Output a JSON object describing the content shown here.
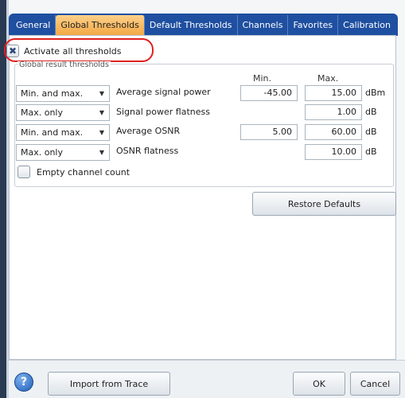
{
  "tabs": [
    {
      "label": "General",
      "active": false
    },
    {
      "label": "Global Thresholds",
      "active": true
    },
    {
      "label": "Default Thresholds",
      "active": false
    },
    {
      "label": "Channels",
      "active": false
    },
    {
      "label": "Favorites",
      "active": false
    },
    {
      "label": "Calibration",
      "active": false
    }
  ],
  "activate_all": {
    "label": "Activate all thresholds",
    "checked": true,
    "mark": "✖"
  },
  "group_title": "Global result thresholds",
  "columns": {
    "min": "Min.",
    "max": "Max."
  },
  "rows": [
    {
      "mode": "Min. and max.",
      "label": "Average signal power",
      "min": "-45.00",
      "max": "15.00",
      "unit": "dBm"
    },
    {
      "mode": "Max. only",
      "label": "Signal power flatness",
      "min": "",
      "max": "1.00",
      "unit": "dB"
    },
    {
      "mode": "Min. and max.",
      "label": "Average OSNR",
      "min": "5.00",
      "max": "60.00",
      "unit": "dB"
    },
    {
      "mode": "Max. only",
      "label": "OSNR flatness",
      "min": "",
      "max": "10.00",
      "unit": "dB"
    }
  ],
  "empty_channel": {
    "label": "Empty channel count",
    "checked": false
  },
  "buttons": {
    "restore": "Restore Defaults",
    "import": "Import from Trace",
    "ok": "OK",
    "cancel": "Cancel",
    "help": "?"
  },
  "colors": {
    "tab_bar": "#1f4fa0",
    "active_tab": "#f3a742",
    "highlight": "#e02020"
  }
}
